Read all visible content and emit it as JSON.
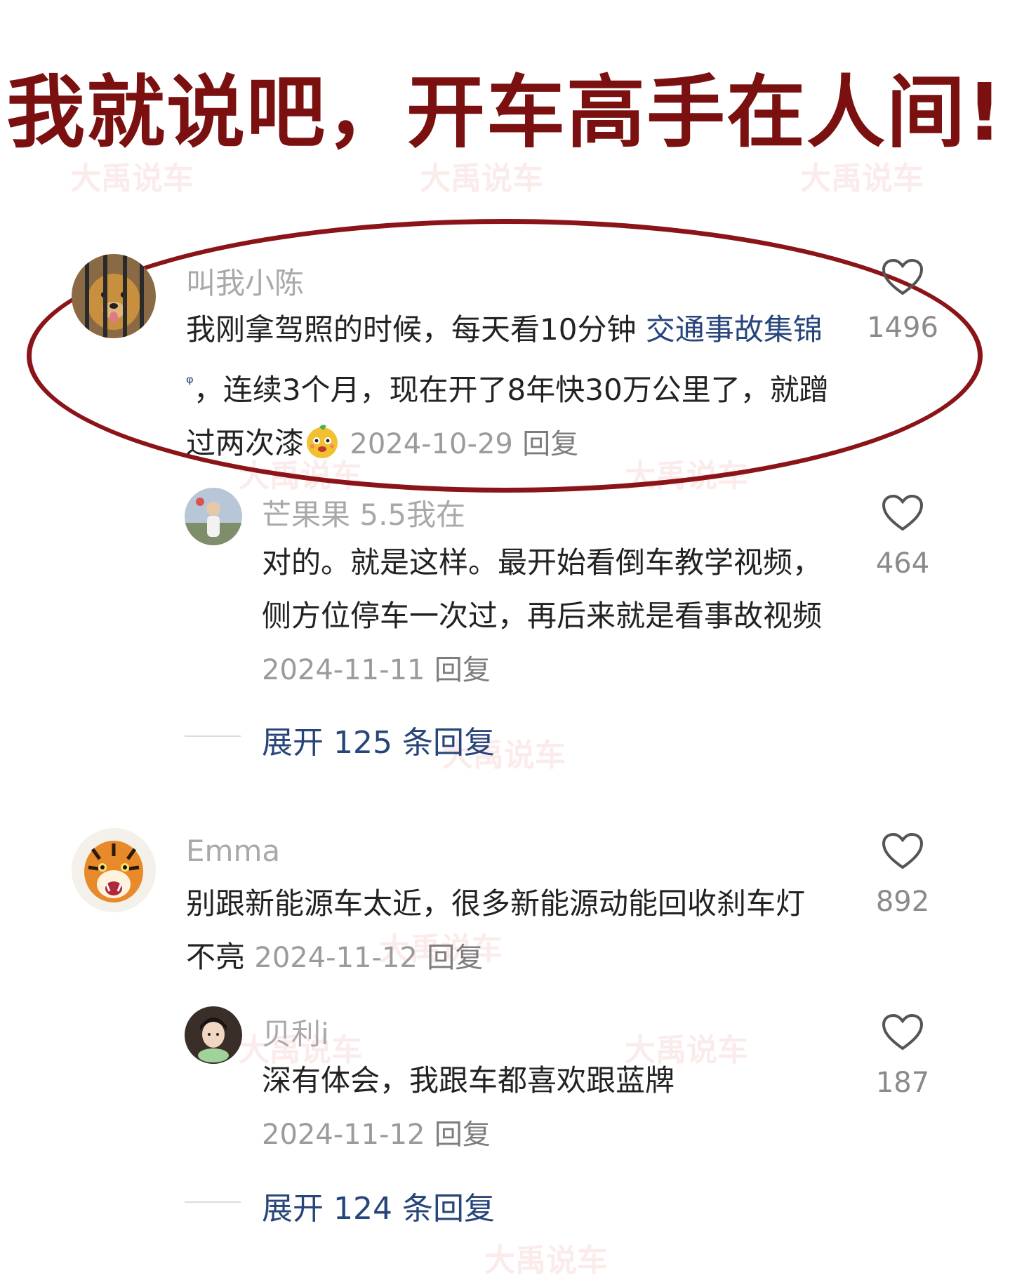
{
  "headline": "我就说吧，开车高手在人间!",
  "watermark": "大禹说车",
  "comments": [
    {
      "user": "叫我小陈",
      "text_pre": "我刚拿驾照的时候，每天看10分钟",
      "link": "交通事故集锦",
      "search_mark": "ᵠ",
      "text_post": "，连续3个月，现在开了8年快30万公里了，就蹭过两次漆",
      "date": "2024-10-29",
      "reply": "回复",
      "likes": "1496"
    },
    {
      "user": "芒果果 5.5我在",
      "text": "对的。就是这样。最开始看倒车教学视频，侧方位停车一次过，再后来就是看事故视频",
      "date": "2024-11-11",
      "reply": "回复",
      "likes": "464",
      "expand": "展开 125 条回复"
    },
    {
      "user": "Emma",
      "text": "别跟新能源车太近，很多新能源动能回收刹车灯不亮",
      "date": "2024-11-12",
      "reply": "回复",
      "likes": "892"
    },
    {
      "user": "贝利i",
      "text": "深有体会，我跟车都喜欢跟蓝牌",
      "date": "2024-11-12",
      "reply": "回复",
      "likes": "187",
      "expand": "展开 124 条回复"
    }
  ],
  "colors": {
    "headline": "#7a1010",
    "oval": "#8b1418",
    "link": "#27457a",
    "username": "#a9a9a9"
  }
}
